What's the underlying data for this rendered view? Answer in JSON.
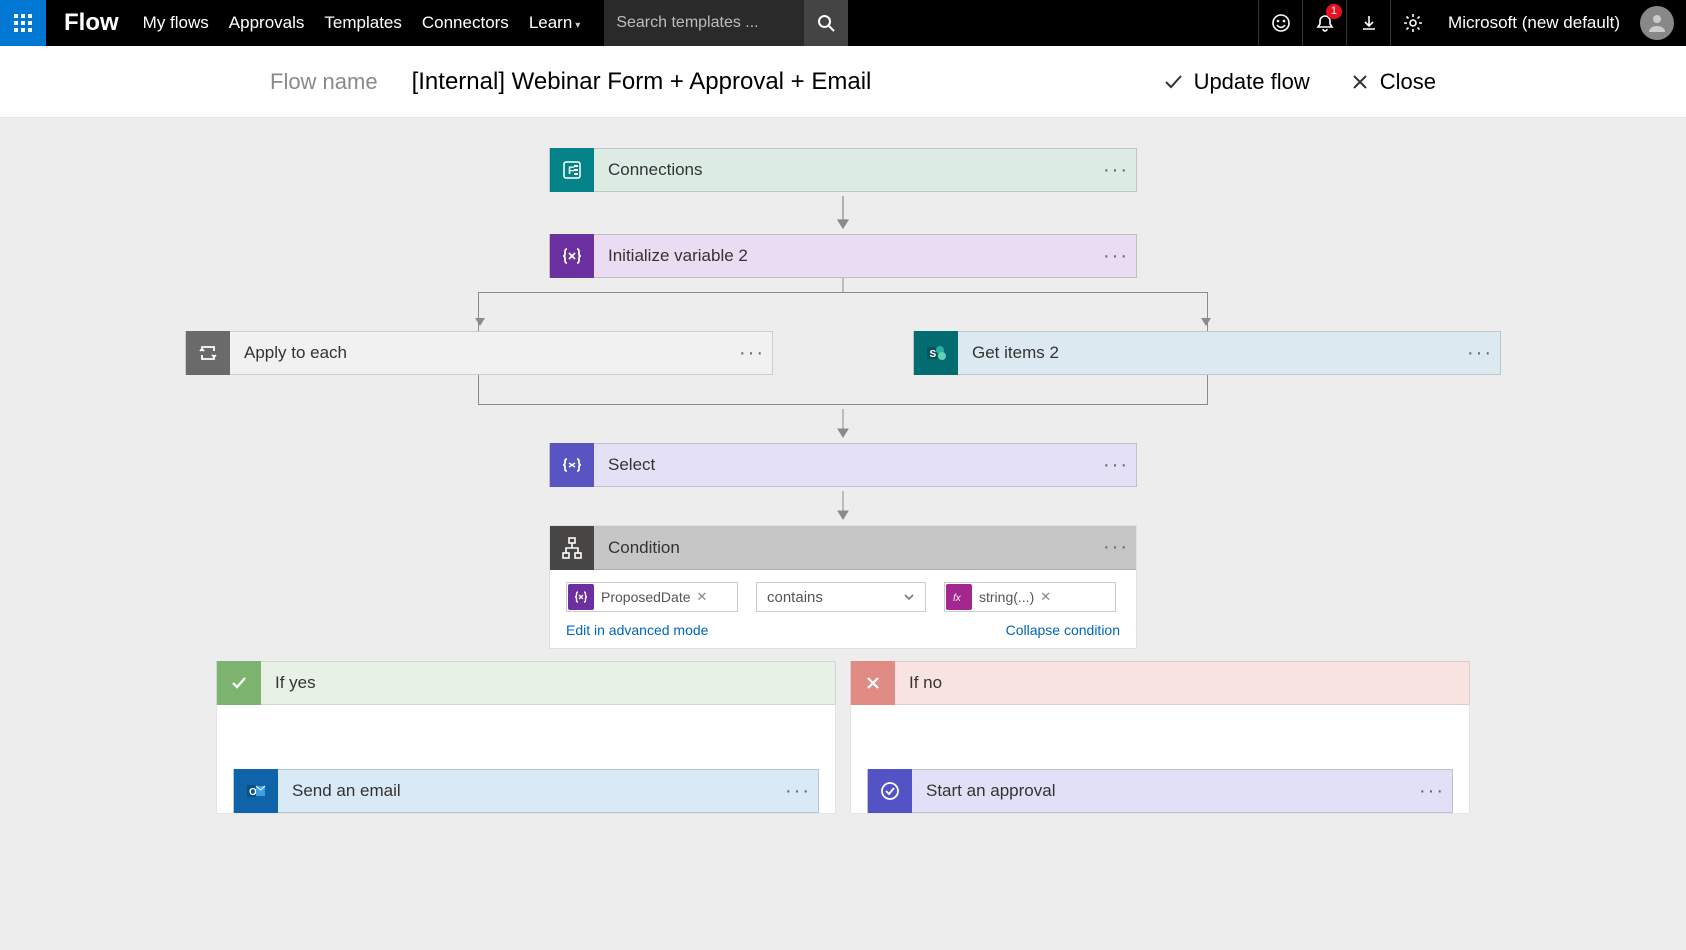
{
  "topnav": {
    "brand": "Flow",
    "links": [
      "My flows",
      "Approvals",
      "Templates",
      "Connectors",
      "Learn"
    ],
    "search_placeholder": "Search templates ...",
    "notification_count": "1",
    "tenant": "Microsoft (new default)"
  },
  "subhead": {
    "label": "Flow name",
    "value": "[Internal] Webinar Form + Approval + Email",
    "update": "Update flow",
    "close": "Close"
  },
  "cards": {
    "connections": "Connections",
    "initvar": "Initialize variable 2",
    "apply": "Apply to each",
    "getitems": "Get items 2",
    "select": "Select",
    "condition": "Condition",
    "ifyes": "If yes",
    "ifno": "If no",
    "sendemail": "Send an email",
    "startapproval": "Start an approval"
  },
  "condition": {
    "left_token": "ProposedDate",
    "operator": "contains",
    "right_token": "string(...)",
    "edit_link": "Edit in advanced mode",
    "collapse_link": "Collapse condition"
  }
}
